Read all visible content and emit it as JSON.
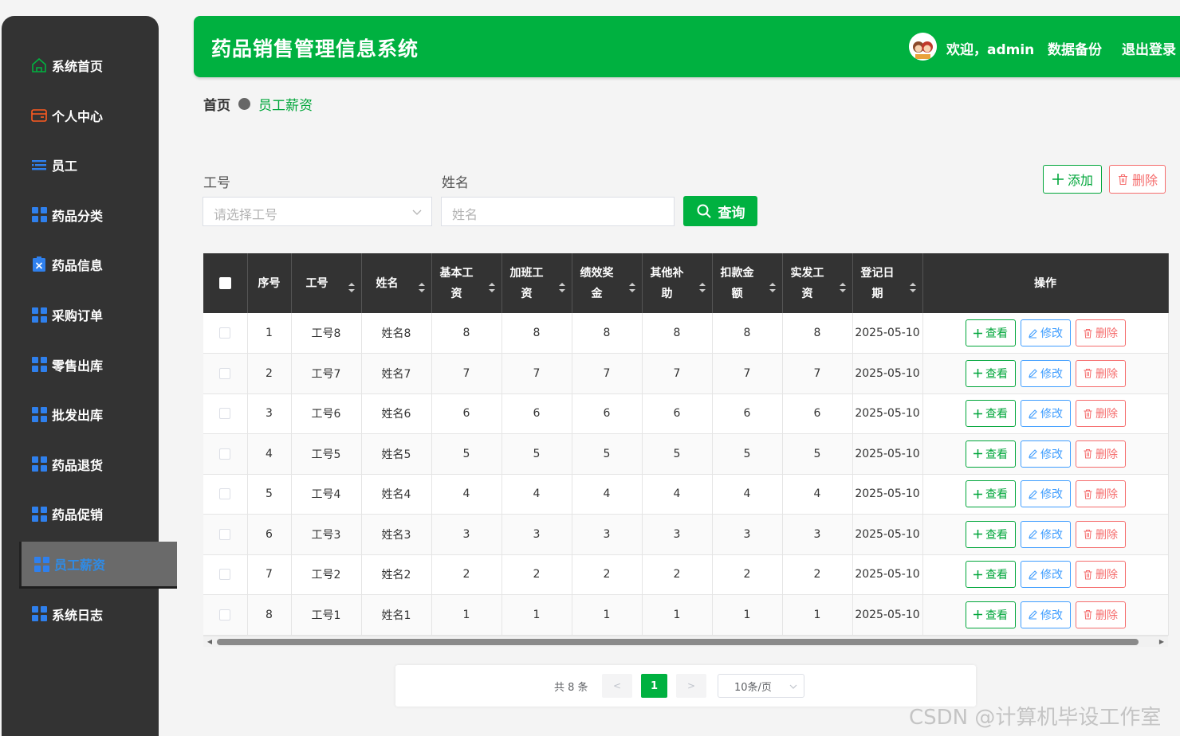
{
  "sidebar": {
    "items": [
      {
        "label": "系统首页",
        "icon": "home-icon"
      },
      {
        "label": "个人中心",
        "icon": "wallet-icon"
      },
      {
        "label": "员工",
        "icon": "list-icon"
      },
      {
        "label": "药品分类",
        "icon": "grid-icon"
      },
      {
        "label": "药品信息",
        "icon": "clipboard-x-icon"
      },
      {
        "label": "采购订单",
        "icon": "grid-icon"
      },
      {
        "label": "零售出库",
        "icon": "grid-icon"
      },
      {
        "label": "批发出库",
        "icon": "grid-icon"
      },
      {
        "label": "药品退货",
        "icon": "grid-icon"
      },
      {
        "label": "药品促销",
        "icon": "grid-icon"
      },
      {
        "label": "员工薪资",
        "icon": "grid-icon",
        "active": true
      },
      {
        "label": "系统日志",
        "icon": "grid-icon"
      }
    ]
  },
  "header": {
    "title": "药品销售管理信息系统",
    "welcome": "欢迎，admin",
    "backup": "数据备份",
    "logout": "退出登录"
  },
  "breadcrumb": {
    "home": "首页",
    "current": "员工薪资"
  },
  "search": {
    "emp_no_label": "工号",
    "emp_no_placeholder": "请选择工号",
    "name_label": "姓名",
    "name_placeholder": "姓名",
    "query_label": "查询"
  },
  "actions": {
    "add_label": "添加",
    "delete_label": "删除"
  },
  "table": {
    "columns": [
      {
        "line1": "序号",
        "line2": "",
        "sortable": false
      },
      {
        "line1": "工号",
        "line2": "",
        "sortable": true
      },
      {
        "line1": "姓名",
        "line2": "",
        "sortable": true
      },
      {
        "line1": "基本工",
        "line2": "资",
        "sortable": true
      },
      {
        "line1": "加班工",
        "line2": "资",
        "sortable": true
      },
      {
        "line1": "绩效奖",
        "line2": "金",
        "sortable": true
      },
      {
        "line1": "其他补",
        "line2": "助",
        "sortable": true
      },
      {
        "line1": "扣款金",
        "line2": "额",
        "sortable": true
      },
      {
        "line1": "实发工",
        "line2": "资",
        "sortable": true
      },
      {
        "line1": "登记日",
        "line2": "期",
        "sortable": true
      },
      {
        "line1": "操作",
        "line2": "",
        "sortable": false
      }
    ],
    "rows": [
      [
        "1",
        "工号8",
        "姓名8",
        "8",
        "8",
        "8",
        "8",
        "8",
        "8",
        "2025-05-10"
      ],
      [
        "2",
        "工号7",
        "姓名7",
        "7",
        "7",
        "7",
        "7",
        "7",
        "7",
        "2025-05-10"
      ],
      [
        "3",
        "工号6",
        "姓名6",
        "6",
        "6",
        "6",
        "6",
        "6",
        "6",
        "2025-05-10"
      ],
      [
        "4",
        "工号5",
        "姓名5",
        "5",
        "5",
        "5",
        "5",
        "5",
        "5",
        "2025-05-10"
      ],
      [
        "5",
        "工号4",
        "姓名4",
        "4",
        "4",
        "4",
        "4",
        "4",
        "4",
        "2025-05-10"
      ],
      [
        "6",
        "工号3",
        "姓名3",
        "3",
        "3",
        "3",
        "3",
        "3",
        "3",
        "2025-05-10"
      ],
      [
        "7",
        "工号2",
        "姓名2",
        "2",
        "2",
        "2",
        "2",
        "2",
        "2",
        "2025-05-10"
      ],
      [
        "8",
        "工号1",
        "姓名1",
        "1",
        "1",
        "1",
        "1",
        "1",
        "1",
        "2025-05-10"
      ]
    ],
    "row_actions": {
      "view": "查看",
      "edit": "修改",
      "delete": "删除"
    }
  },
  "pagination": {
    "total": "共 8 条",
    "prev": "<",
    "page": "1",
    "next": ">",
    "page_size": "10条/页"
  },
  "watermark": "CSDN @计算机毕设工作室",
  "colors": {
    "primary": "#00b140",
    "sidebar": "#333333",
    "danger": "#f56c6c",
    "info": "#409eff"
  }
}
